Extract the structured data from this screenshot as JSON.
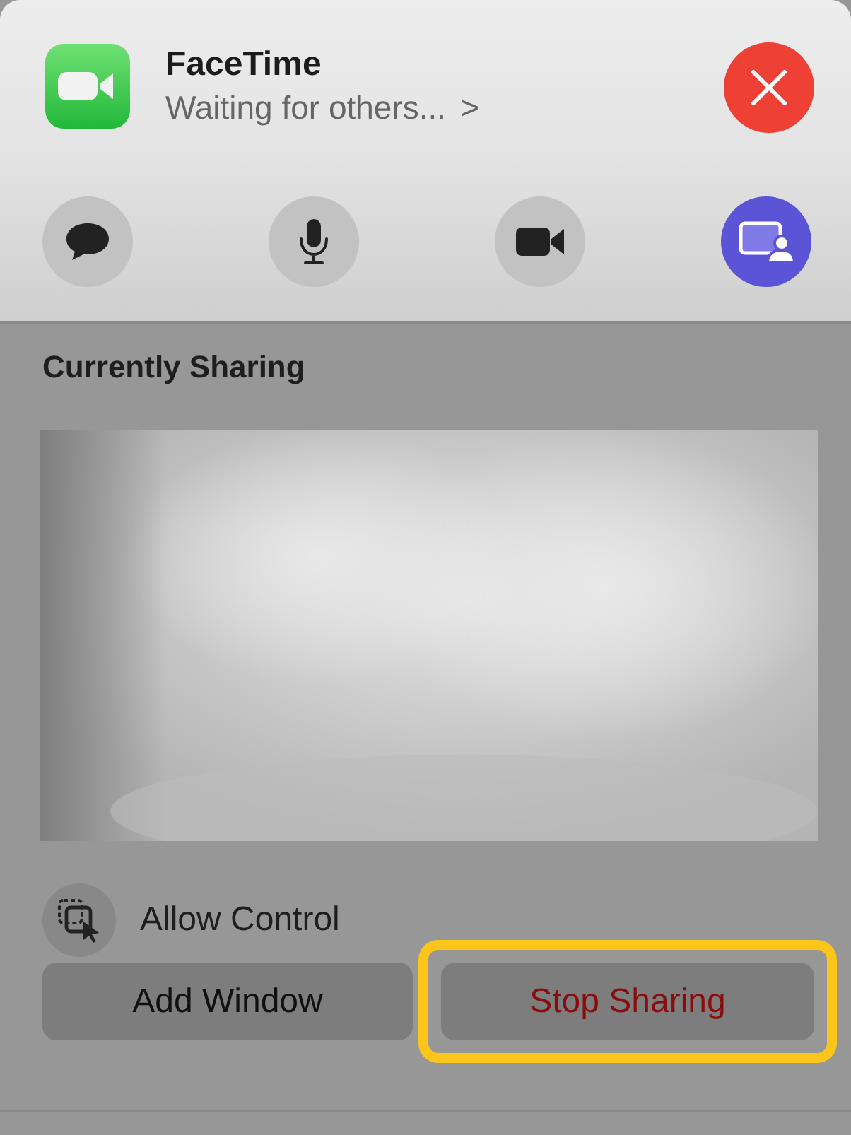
{
  "app": {
    "title": "FaceTime",
    "status": "Waiting for others...",
    "status_chevron": ">"
  },
  "controls": [
    {
      "kind": "messages",
      "on": false
    },
    {
      "kind": "microphone",
      "on": false
    },
    {
      "kind": "camera",
      "on": false
    },
    {
      "kind": "screen-share",
      "on": true
    }
  ],
  "sharing": {
    "heading": "Currently Sharing"
  },
  "allow_control": {
    "label": "Allow Control"
  },
  "buttons": [
    {
      "label": "Add Window",
      "kind": "normal",
      "highlighted": false
    },
    {
      "label": "Stop Sharing",
      "kind": "destructive",
      "highlighted": true
    }
  ]
}
